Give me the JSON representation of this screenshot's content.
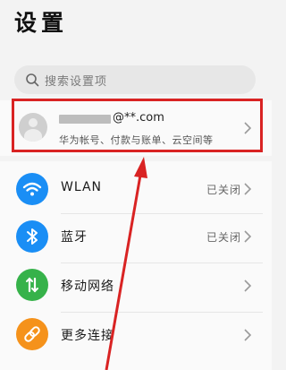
{
  "page": {
    "title": "设置"
  },
  "search": {
    "placeholder": "搜索设置项",
    "icon": "search-icon"
  },
  "account": {
    "email_suffix": "@**.com",
    "subtitle": "华为帐号、付款与账单、云空间等",
    "icon": "avatar-icon"
  },
  "settings": [
    {
      "label": "WLAN",
      "value": "已关闭",
      "icon": "wifi-icon",
      "color": "#1a8ef5"
    },
    {
      "label": "蓝牙",
      "value": "已关闭",
      "icon": "bluetooth-icon",
      "color": "#1a8ef5"
    },
    {
      "label": "移动网络",
      "value": "",
      "icon": "mobile-network-icon",
      "color": "#36b24a"
    },
    {
      "label": "更多连接",
      "value": "",
      "icon": "link-icon",
      "color": "#f5921b"
    }
  ],
  "annotation": {
    "highlight_color": "#d92323"
  }
}
